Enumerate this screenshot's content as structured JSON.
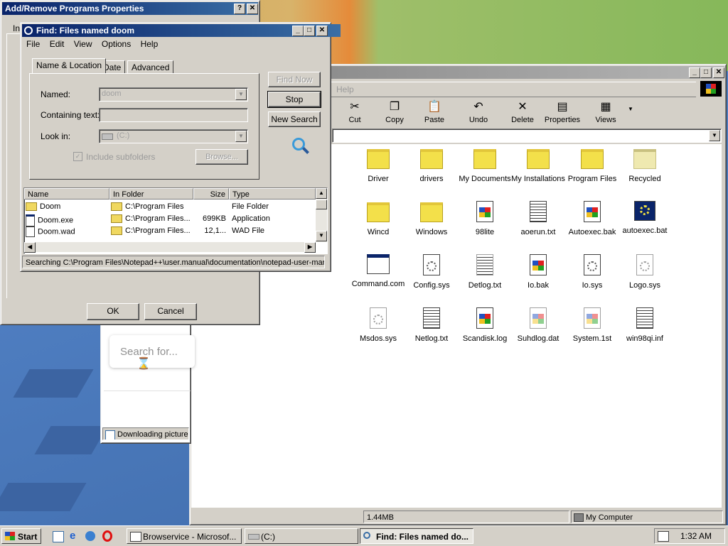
{
  "addremove": {
    "title": "Add/Remove Programs Properties",
    "tab_fragment": "In",
    "ok_label": "OK",
    "cancel_label": "Cancel"
  },
  "find": {
    "title": "Find: Files named doom",
    "menu": [
      "File",
      "Edit",
      "View",
      "Options",
      "Help"
    ],
    "tabs": [
      "Name & Location",
      "Date",
      "Advanced"
    ],
    "named_label": "Named:",
    "named_value": "doom",
    "containing_label": "Containing text:",
    "containing_value": "",
    "lookin_label": "Look in:",
    "lookin_value": "(C:)",
    "include_subfolders_label": "Include subfolders",
    "browse_label": "Browse...",
    "find_now_label": "Find Now",
    "stop_label": "Stop",
    "new_search_label": "New Search",
    "columns": [
      "Name",
      "In Folder",
      "Size",
      "Type"
    ],
    "results": [
      {
        "name": "Doom",
        "folder": "C:\\Program Files",
        "size": "",
        "type": "File Folder",
        "icon": "folder-icon"
      },
      {
        "name": "Doom.exe",
        "folder": "C:\\Program Files...",
        "size": "699KB",
        "type": "Application",
        "icon": "application-icon"
      },
      {
        "name": "Doom.wad",
        "folder": "C:\\Program Files...",
        "size": "12,1...",
        "type": "WAD File",
        "icon": "document-icon"
      }
    ],
    "status": "Searching C:\\Program Files\\Notepad++\\user.manual\\documentation\\notepad-user-mar"
  },
  "explorer": {
    "menu_help": "Help",
    "toolbar": [
      "Cut",
      "Copy",
      "Paste",
      "Undo",
      "Delete",
      "Properties",
      "Views"
    ],
    "status_size": "1.44MB",
    "status_location": "My Computer",
    "items": [
      {
        "label": "Driver",
        "icon": "folder-icon"
      },
      {
        "label": "drivers",
        "icon": "folder-icon"
      },
      {
        "label": "My Documents",
        "icon": "folder-icon"
      },
      {
        "label": "My Installations",
        "icon": "folder-icon"
      },
      {
        "label": "Program Files",
        "icon": "folder-icon"
      },
      {
        "label": "Recycled",
        "icon": "recycle-folder-icon"
      },
      {
        "label": "Wincd",
        "icon": "folder-icon"
      },
      {
        "label": "Windows",
        "icon": "folder-icon"
      },
      {
        "label": "98lite",
        "icon": "windows-file-icon"
      },
      {
        "label": "aoerun.txt",
        "icon": "text-file-icon"
      },
      {
        "label": "Autoexec.bak",
        "icon": "windows-file-icon"
      },
      {
        "label": "autoexec.bat",
        "icon": "batch-file-icon"
      },
      {
        "label": "Command.com",
        "icon": "application-icon"
      },
      {
        "label": "Config.sys",
        "icon": "system-file-icon"
      },
      {
        "label": "Detlog.txt",
        "icon": "text-file-icon"
      },
      {
        "label": "Io.bak",
        "icon": "windows-file-icon"
      },
      {
        "label": "Io.sys",
        "icon": "system-file-icon"
      },
      {
        "label": "Logo.sys",
        "icon": "system-file-icon"
      },
      {
        "label": "Msdos.sys",
        "icon": "system-file-icon"
      },
      {
        "label": "Netlog.txt",
        "icon": "text-file-icon"
      },
      {
        "label": "Scandisk.log",
        "icon": "windows-file-icon"
      },
      {
        "label": "Suhdlog.dat",
        "icon": "windows-file-icon"
      },
      {
        "label": "System.1st",
        "icon": "windows-file-icon"
      },
      {
        "label": "win98qi.inf",
        "icon": "setup-info-icon"
      }
    ]
  },
  "browser": {
    "search_placeholder": "Search for...",
    "status": "Downloading picture"
  },
  "taskbar": {
    "start_label": "Start",
    "tasks": [
      "Browservice - Microsof...",
      "(C:)",
      "Find: Files named do..."
    ],
    "clock": "1:32 AM"
  }
}
